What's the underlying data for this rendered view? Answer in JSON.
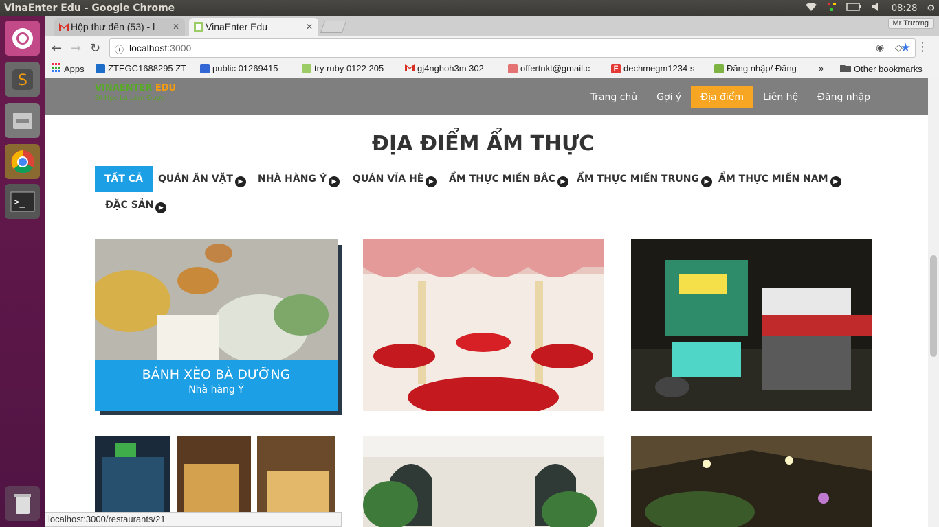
{
  "os": {
    "window_title": "VinaEnter Edu - Google Chrome",
    "clock": "08:28"
  },
  "browser": {
    "tabs": [
      {
        "label": "Hộp thư đến (53) - l"
      },
      {
        "label": "VinaEnter Edu"
      }
    ],
    "profile": "Mr Trương",
    "url_host": "localhost",
    "url_port": ":3000",
    "bookmarks": [
      {
        "label": "Apps"
      },
      {
        "label": "ZTEGC1688295 ZT"
      },
      {
        "label": "public 01269415"
      },
      {
        "label": "try ruby 0122 205"
      },
      {
        "label": "gj4nghoh3m  302"
      },
      {
        "label": "offertnkt@gmail.c"
      },
      {
        "label": "dechmegm1234  s"
      },
      {
        "label": "Đăng nhập/ Đăng"
      },
      {
        "label": "»"
      },
      {
        "label": "Other bookmarks"
      }
    ]
  },
  "site": {
    "logo_main": "VINAENTER",
    "logo_edu": "EDU",
    "logo_tagline": "Đi Học Là Làm Được",
    "nav": [
      {
        "label": "Trang chủ"
      },
      {
        "label": "Gợi ý"
      },
      {
        "label": "Địa điểm"
      },
      {
        "label": "Liên hệ"
      },
      {
        "label": "Đăng nhập"
      }
    ],
    "section_title": "ĐỊA ĐIỂM ẨM THỰC",
    "filters": [
      {
        "label": "TẤT CẢ"
      },
      {
        "label": "QUÁN ĂN VẶT"
      },
      {
        "label": "NHÀ HÀNG Ý"
      },
      {
        "label": "QUÁN VỈA HÈ"
      },
      {
        "label": "ẨM THỰC MIỀN BẮC"
      },
      {
        "label": "ẨM THỰC MIỀN TRUNG"
      },
      {
        "label": "ẨM THỰC MIỀN NAM"
      },
      {
        "label": "ĐẶC SẢN"
      }
    ],
    "cards": [
      {
        "title": "BÁNH XÈO BÀ DƯỠNG",
        "subtitle": "Nhà hàng Ý"
      }
    ],
    "status_url": "localhost:3000/restaurants/21"
  },
  "colors": {
    "accent_blue": "#1d9fe5",
    "nav_active": "#f6a623",
    "header_gray": "#7f7f7f"
  }
}
